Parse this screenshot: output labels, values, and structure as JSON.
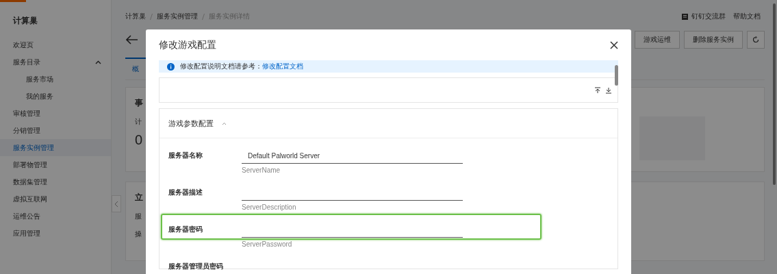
{
  "sidebar": {
    "title": "计算巢",
    "items": [
      {
        "label": "欢迎页",
        "selected": false
      },
      {
        "label": "服务目录",
        "selected": false,
        "expanded": true,
        "children": [
          {
            "label": "服务市场",
            "selected": false
          },
          {
            "label": "我的服务",
            "selected": false
          }
        ]
      },
      {
        "label": "审核管理",
        "selected": false
      },
      {
        "label": "分销管理",
        "selected": false
      },
      {
        "label": "服务实例管理",
        "selected": true
      },
      {
        "label": "部署物管理",
        "selected": false
      },
      {
        "label": "数据集管理",
        "selected": false
      },
      {
        "label": "虚拟互联网",
        "selected": false
      },
      {
        "label": "运维公告",
        "selected": false
      },
      {
        "label": "应用管理",
        "selected": false
      }
    ]
  },
  "breadcrumb": [
    "计算巢",
    "服务实例管理",
    "服务实例详情"
  ],
  "header_links": [
    "钉钉交流群",
    "帮助文档"
  ],
  "actions": [
    "游戏运维",
    "删除服务实例"
  ],
  "tabs": [
    {
      "label": "概",
      "selected": true
    }
  ],
  "cards": [
    {
      "title": "事",
      "stat_label": "计",
      "stat_value": "0"
    },
    {
      "title": "立",
      "rows": [
        "服",
        "操"
      ]
    }
  ],
  "dialog": {
    "title": "修改游戏配置",
    "notice": {
      "text": "修改配置说明文档请参考：",
      "link": "修改配置文档"
    },
    "section": {
      "title": "游戏参数配置",
      "expanded": true,
      "fields": [
        {
          "label": "服务器名称",
          "value": "Default Palworld Server",
          "hint": "ServerName",
          "highlighted": false
        },
        {
          "label": "服务器描述",
          "hint": "ServerDescription",
          "highlighted": false
        },
        {
          "label": "服务器密码",
          "hint": "ServerPassword",
          "highlighted": true
        },
        {
          "label": "服务器管理员密码",
          "highlighted": false
        }
      ]
    }
  }
}
